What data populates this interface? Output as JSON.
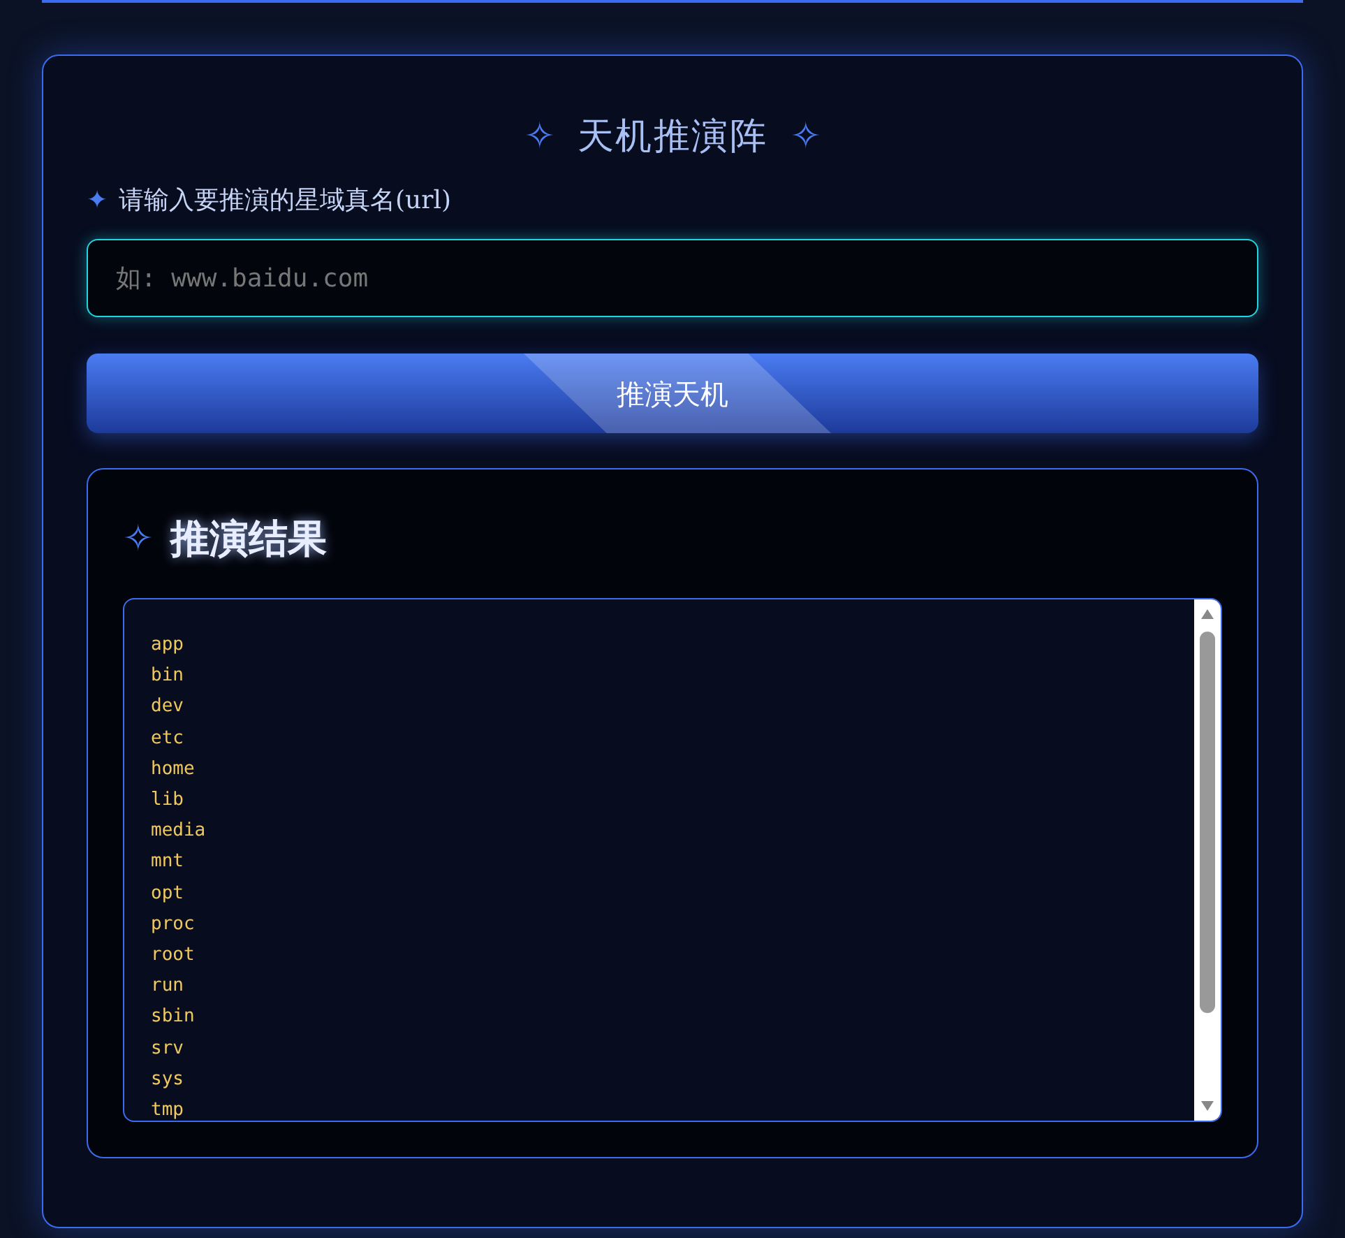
{
  "title": {
    "icon_left": "✧",
    "text": "天机推演阵",
    "icon_right": "✧"
  },
  "input": {
    "label_icon": "✦",
    "label": "请输入要推演的星域真名(url)",
    "placeholder": "如: www.baidu.com"
  },
  "button": {
    "label": "推演天机"
  },
  "results": {
    "icon": "✧",
    "heading": "推演结果",
    "lines": [
      "app",
      "bin",
      "dev",
      "etc",
      "home",
      "lib",
      "media",
      "mnt",
      "opt",
      "proc",
      "root",
      "run",
      "sbin",
      "srv",
      "sys",
      "tmp"
    ]
  }
}
